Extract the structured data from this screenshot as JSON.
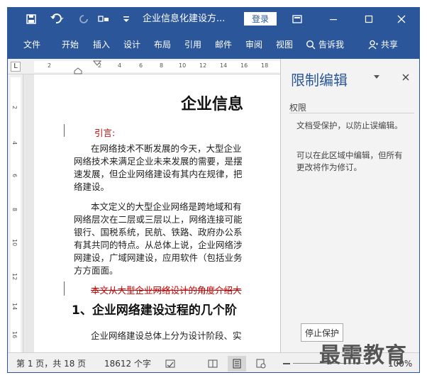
{
  "titlebar": {
    "doc_title": "企业信息化建设方...",
    "login_label": "登录"
  },
  "ribbon": {
    "tabs": [
      "文件",
      "开始",
      "插入",
      "设计",
      "布局",
      "引用",
      "邮件",
      "审阅",
      "视图"
    ],
    "tell_me": "告诉我",
    "share": "共享"
  },
  "ruler": {
    "corner": "L",
    "h_ticks": [
      "2",
      "2",
      "4",
      "6",
      "8",
      "10",
      "12",
      "14",
      "16",
      "18"
    ],
    "v_ticks": [
      "2",
      "4",
      "6",
      "8",
      "10",
      "12",
      "14",
      "16"
    ]
  },
  "document": {
    "title": "企业信息",
    "intro_label": "引言:",
    "para1": [
      "在网络技术不断发展的今天，大型企业",
      "网络技术来满足企业未来发展的需要，是摆",
      "速发展，但企业网络建设有其内在规律，把",
      "络建设。"
    ],
    "para2": [
      "本文定义的大型企业网络是跨地域和有",
      "网络层次在二层或三层以上，网络连接可能",
      "银行、国税系统，民航、铁路、政府办公系",
      "有其共同的特点。从总体上说，企业网络涉",
      "网建设，广域网建设，应用软件（包括业务",
      "方方面面。"
    ],
    "deleted_line": "本文从大型企业网络设计的角度介绍大",
    "heading": "1、企业网络建设过程的几个阶",
    "para3": "企业网络建设总体上分为设计阶段、实"
  },
  "pane": {
    "title": "限制编辑",
    "subtitle": "权限",
    "text1": "文档受保护，以防止误编辑。",
    "text2": "可以在此区域中编辑，但所有更改将作为修订。",
    "stop_button": "停止保护"
  },
  "statusbar": {
    "page_info": "第 1 页，共 18 页",
    "word_count": "18612 个字",
    "zoom": "100%"
  },
  "watermark": "最需教育",
  "colors": {
    "accent": "#2b579a",
    "revision_red": "#c00000"
  }
}
